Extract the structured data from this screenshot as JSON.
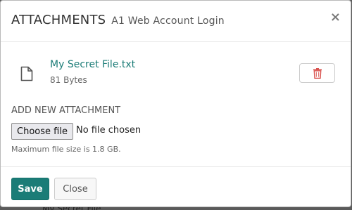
{
  "background": {
    "partial_text": "Mv Secret File"
  },
  "modal": {
    "title": "ATTACHMENTS",
    "subtitle": "A1 Web Account Login",
    "close_symbol": "×"
  },
  "attachment": {
    "file_name": "My Secret File.txt",
    "file_size": "81 Bytes",
    "icon": "file-icon",
    "delete_icon": "trash-icon"
  },
  "add_new": {
    "label": "ADD NEW ATTACHMENT",
    "choose_button": "Choose file",
    "no_file_text": "No file chosen",
    "max_size_note": "Maximum file size is 1.8 GB."
  },
  "footer": {
    "save_label": "Save",
    "close_label": "Close"
  },
  "colors": {
    "accent": "#1b7c77",
    "danger": "#d9534f",
    "overlay": "#5a5a5a"
  }
}
